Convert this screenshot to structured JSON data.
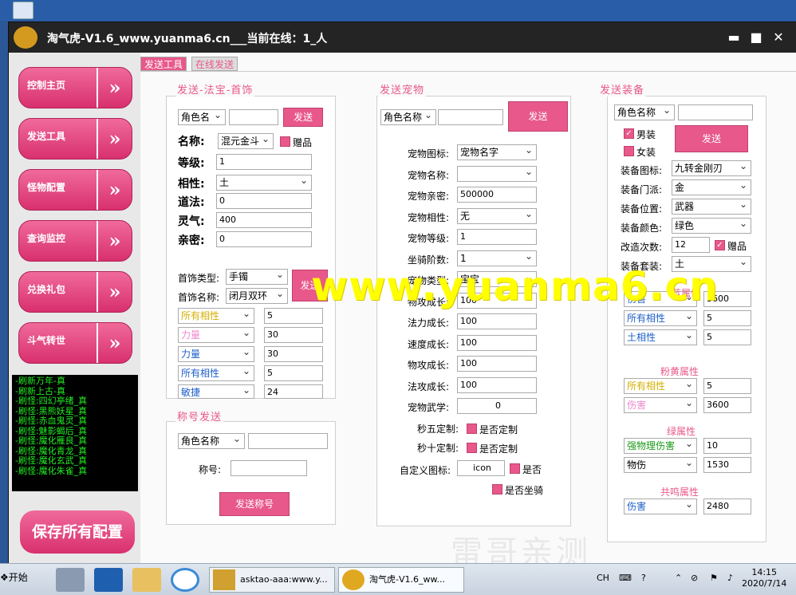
{
  "window": {
    "title": "淘气虎-V1.6_www.yuanma6.cn___当前在线：1_人",
    "min": "▬",
    "max": "■",
    "close": "✕"
  },
  "nav": [
    "控制主页",
    "发送工具",
    "怪物配置",
    "查询监控",
    "兑换礼包",
    "斗气转世"
  ],
  "nav_arrow": "»",
  "log": [
    "-刷新万年-真",
    "-刷新上古-真",
    "-刷怪:四幻亭绪_真",
    "-刷怪:黑熊妖星_真",
    "-刷怪:赤血鬼灵_真",
    "-刷怪:魅影蝎后_真",
    "-刷怪:魔化雁良_真",
    "-刷怪:魔化青龙_真",
    "-刷怪:魔化玄武_真",
    "-刷怪:魔化朱雀_真"
  ],
  "save_all": "保存所有配置",
  "tabs": [
    "发送工具",
    "在线发送"
  ],
  "fabao": {
    "title": "发送-法宝-首饰",
    "role": "角色名",
    "send": "发送",
    "name_lbl": "名称:",
    "name_val": "混元金斗",
    "gift": "赠品",
    "level_lbl": "等级:",
    "level_val": "1",
    "xiang_lbl": "相性:",
    "xiang_val": "土",
    "dao_lbl": "道法:",
    "dao_val": "0",
    "lq_lbl": "灵气:",
    "lq_val": "400",
    "qm_lbl": "亲密:",
    "qm_val": "0",
    "sp_type_lbl": "首饰类型:",
    "sp_type_val": "手镯",
    "sp_name_lbl": "首饰名称:",
    "sp_name_val": "闭月双环",
    "send2": "发送",
    "attrs": [
      {
        "k": "所有相性",
        "v": "5",
        "c": "y"
      },
      {
        "k": "力量",
        "v": "30",
        "c": "p"
      },
      {
        "k": "力量",
        "v": "30",
        "c": "b"
      },
      {
        "k": "所有相性",
        "v": "5",
        "c": "b"
      },
      {
        "k": "敏捷",
        "v": "24",
        "c": "b"
      }
    ]
  },
  "chenghao": {
    "title": "称号发送",
    "role": "角色名称",
    "lbl": "称号:",
    "btn": "发送称号"
  },
  "pet": {
    "title": "发送宠物",
    "role": "角色名称",
    "send": "发送",
    "rows": [
      {
        "k": "宠物图标:",
        "v": "宠物名字",
        "s": true
      },
      {
        "k": "宠物名称:",
        "v": "",
        "s": true
      },
      {
        "k": "宠物亲密:",
        "v": "500000",
        "s": false
      },
      {
        "k": "宠物相性:",
        "v": "无",
        "s": true
      },
      {
        "k": "宠物等级:",
        "v": "1",
        "s": false
      },
      {
        "k": "坐骑阶数:",
        "v": "1",
        "s": true
      },
      {
        "k": "宠物类型:",
        "v": "宝宝",
        "s": true
      },
      {
        "k": "物攻成长:",
        "v": "100",
        "s": false
      },
      {
        "k": "法力成长:",
        "v": "100",
        "s": false
      },
      {
        "k": "速度成长:",
        "v": "100",
        "s": false
      },
      {
        "k": "物攻成长:",
        "v": "100",
        "s": false
      },
      {
        "k": "法攻成长:",
        "v": "100",
        "s": false
      },
      {
        "k": "宠物武学:",
        "v": "0",
        "s": false
      }
    ],
    "m5_lbl": "秒五定制:",
    "m10_lbl": "秒十定制:",
    "custom": "是否定制",
    "icon_lbl": "自定义图标:",
    "icon_val": "icon",
    "yesno": "是否",
    "mount": "是否坐骑"
  },
  "equip": {
    "title": "发送装备",
    "role": "角色名称",
    "male": "男装",
    "female": "女装",
    "send": "发送",
    "rows": [
      {
        "k": "装备图标:",
        "v": "九转金刚刃"
      },
      {
        "k": "装备门派:",
        "v": "金"
      },
      {
        "k": "装备位置:",
        "v": "武器"
      },
      {
        "k": "装备颜色:",
        "v": "绿色"
      }
    ],
    "gz_lbl": "改造次数:",
    "gz_val": "12",
    "gift": "赠品",
    "tz_lbl": "装备套装:",
    "tz_val": "土",
    "blue_title": "蓝属性",
    "blue": [
      {
        "k": "伤害",
        "v": "3600"
      },
      {
        "k": "所有相性",
        "v": "5"
      },
      {
        "k": "土相性",
        "v": "5"
      }
    ],
    "pink_title": "粉黄属性",
    "pink": [
      {
        "k": "所有相性",
        "v": "5",
        "c": "y"
      },
      {
        "k": "伤害",
        "v": "3600",
        "c": "p"
      }
    ],
    "green_title": "绿属性",
    "green": [
      {
        "k": "强物理伤害",
        "v": "10",
        "c": "g"
      },
      {
        "k": "物伤",
        "v": "1530",
        "c": ""
      }
    ],
    "res_title": "共鸣属性",
    "res": [
      {
        "k": "伤害",
        "v": "2480"
      }
    ]
  },
  "watermark": "www.yuanma6.cn",
  "watermark2": "雷哥亲测",
  "taskbar": {
    "start": "开始",
    "task1": "asktao-aaa:www.y...",
    "task2": "淘气虎-V1.6_ww...",
    "ime": "CH",
    "time": "14:15",
    "date": "2020/7/14"
  }
}
